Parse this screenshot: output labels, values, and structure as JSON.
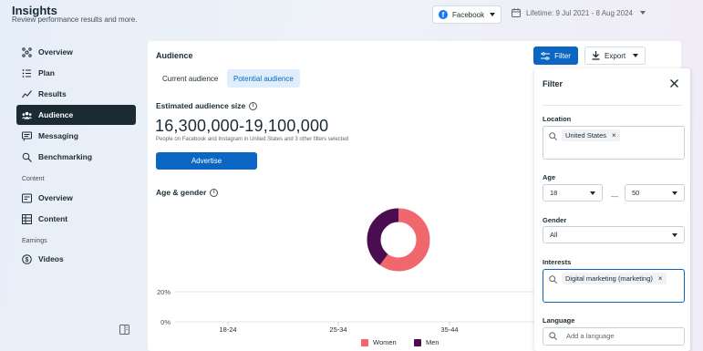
{
  "header": {
    "title": "Insights",
    "subtitle": "Review performance results and more.",
    "platform": "Facebook",
    "date_range": "Lifetime: 9 Jul 2021 - 8 Aug 2024"
  },
  "sidebar": {
    "items": [
      {
        "label": "Overview",
        "icon": "overview-icon"
      },
      {
        "label": "Plan",
        "icon": "plan-icon"
      },
      {
        "label": "Results",
        "icon": "results-icon"
      },
      {
        "label": "Audience",
        "icon": "audience-icon",
        "active": true
      },
      {
        "label": "Messaging",
        "icon": "messaging-icon"
      },
      {
        "label": "Benchmarking",
        "icon": "benchmarking-icon"
      }
    ],
    "content_section": "Content",
    "content_items": [
      {
        "label": "Overview",
        "icon": "content-overview-icon"
      },
      {
        "label": "Content",
        "icon": "content-icon"
      }
    ],
    "earnings_section": "Earnings",
    "earnings_items": [
      {
        "label": "Videos",
        "icon": "dollar-icon"
      }
    ]
  },
  "main": {
    "title": "Audience",
    "tabs": [
      {
        "label": "Current audience",
        "active": false
      },
      {
        "label": "Potential audience",
        "active": true
      }
    ],
    "filter_label": "Filter",
    "export_label": "Export",
    "estimated_heading": "Estimated audience size",
    "audience_size": "16,300,000-19,100,000",
    "audience_note": "People on Facebook and Instagram in United States and 3 other filters selected",
    "advertise_label": "Advertise",
    "age_gender_heading": "Age & gender"
  },
  "chart_data": {
    "type": "bar",
    "categories": [
      "18-24",
      "25-34",
      "35-44"
    ],
    "y_ticks": [
      "20%",
      "0%"
    ],
    "series": [
      {
        "name": "Women",
        "color": "#f0676e"
      },
      {
        "name": "Men",
        "color": "#4a0d4f"
      }
    ],
    "donut": {
      "women": 0.6,
      "men": 0.4
    }
  },
  "filter_panel": {
    "title": "Filter",
    "location_label": "Location",
    "location_chip": "United States",
    "age_label": "Age",
    "age_min": "18",
    "age_max": "50",
    "age_separator": "—",
    "gender_label": "Gender",
    "gender_value": "All",
    "interests_label": "Interests",
    "interest_chip": "Digital marketing (marketing)",
    "language_label": "Language",
    "language_placeholder": "Add a language"
  },
  "colors": {
    "accent": "#0a66c2",
    "women": "#f0676e",
    "men": "#4a0d4f",
    "nav_active": "#1c2b33"
  }
}
